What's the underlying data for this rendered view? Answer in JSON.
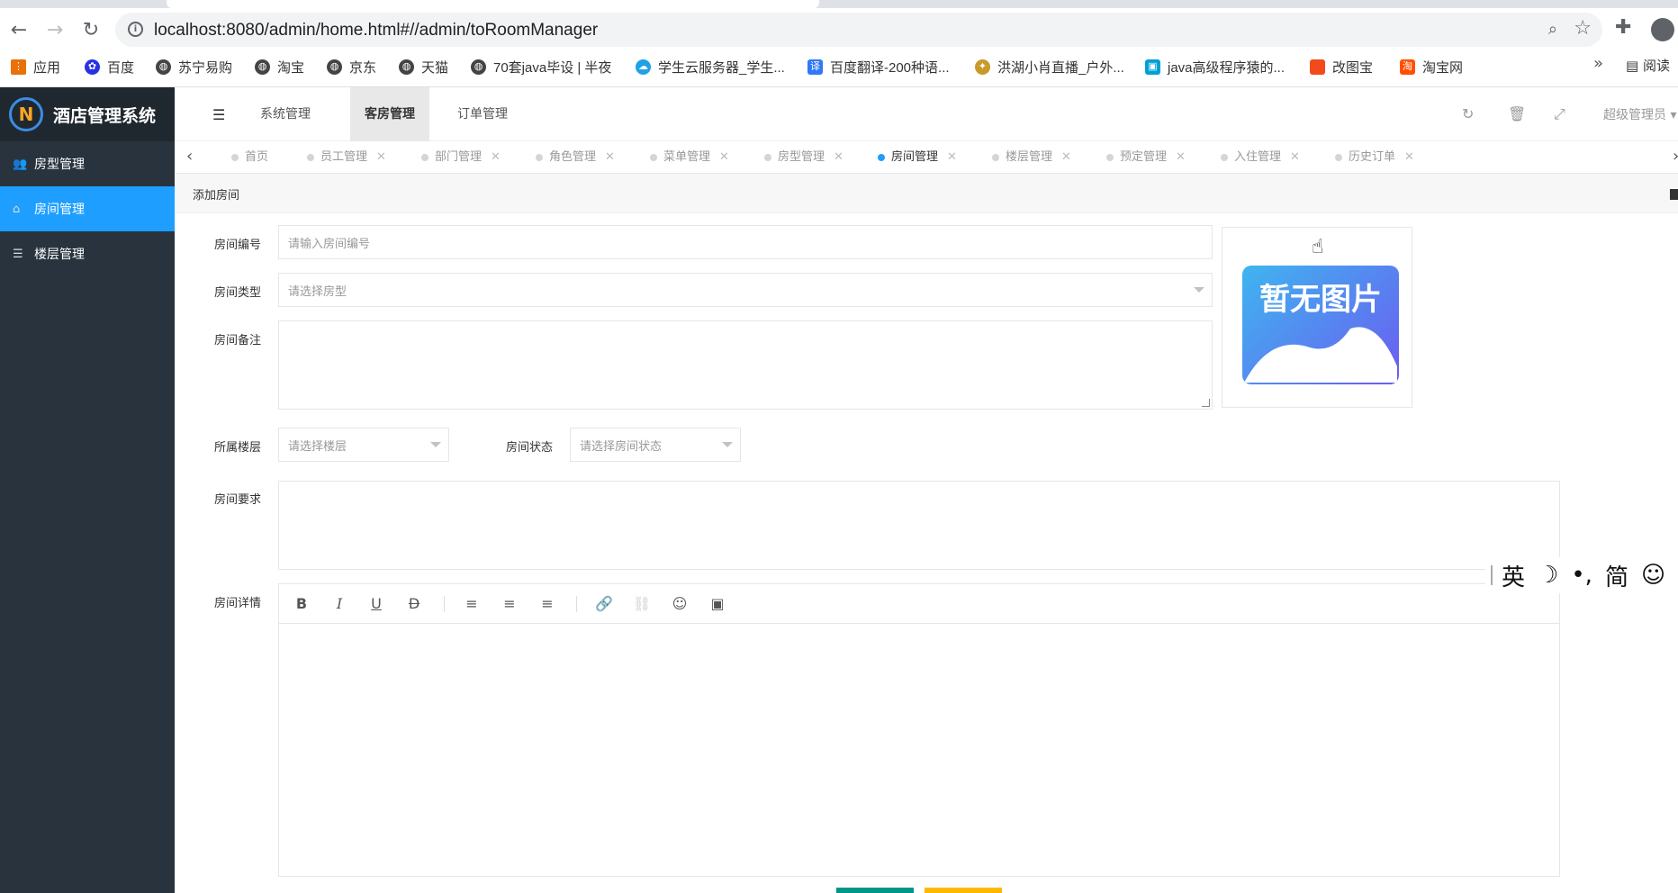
{
  "browser": {
    "url": "localhost:8080/admin/home.html#//admin/toRoomManager",
    "bookmarks": [
      {
        "label": "应用",
        "icon": "apps-grid-icon"
      },
      {
        "label": "百度",
        "icon": "baidu-paw-icon"
      },
      {
        "label": "苏宁易购",
        "icon": "globe-icon"
      },
      {
        "label": "淘宝",
        "icon": "globe-icon"
      },
      {
        "label": "京东",
        "icon": "globe-icon"
      },
      {
        "label": "天猫",
        "icon": "globe-icon"
      },
      {
        "label": "70套java毕设 | 半夜",
        "icon": "globe-icon"
      },
      {
        "label": "学生云服务器_学生...",
        "icon": "cloud-icon"
      },
      {
        "label": "百度翻译-200种语...",
        "icon": "translate-icon"
      },
      {
        "label": "洪湖小肖直播_户外...",
        "icon": "bird-icon"
      },
      {
        "label": "java高级程序猿的...",
        "icon": "bilibili-icon"
      },
      {
        "label": "改图宝",
        "icon": "square-icon"
      },
      {
        "label": "淘宝网",
        "icon": "taobao-icon"
      }
    ],
    "more": "»",
    "reading_list": "阅读"
  },
  "sidebar": {
    "app_title": "酒店管理系统",
    "items": [
      {
        "label": "房型管理",
        "icon": "users-icon",
        "active": false
      },
      {
        "label": "房间管理",
        "icon": "home-icon",
        "active": true
      },
      {
        "label": "楼层管理",
        "icon": "list-icon",
        "active": false
      }
    ]
  },
  "header": {
    "nav": [
      "系统管理",
      "客房管理",
      "订单管理"
    ],
    "active_nav": "客房管理",
    "user": "超级管理员"
  },
  "tabs": [
    {
      "label": "首页",
      "closable": false,
      "active": false
    },
    {
      "label": "员工管理",
      "closable": true,
      "active": false
    },
    {
      "label": "部门管理",
      "closable": true,
      "active": false
    },
    {
      "label": "角色管理",
      "closable": true,
      "active": false
    },
    {
      "label": "菜单管理",
      "closable": true,
      "active": false
    },
    {
      "label": "房型管理",
      "closable": true,
      "active": false
    },
    {
      "label": "房间管理",
      "closable": true,
      "active": true
    },
    {
      "label": "楼层管理",
      "closable": true,
      "active": false
    },
    {
      "label": "预定管理",
      "closable": true,
      "active": false
    },
    {
      "label": "入住管理",
      "closable": true,
      "active": false
    },
    {
      "label": "历史订单",
      "closable": true,
      "active": false
    }
  ],
  "breadcrumb": "添加房间",
  "form": {
    "room_no_label": "房间编号",
    "room_no_placeholder": "请输入房间编号",
    "room_type_label": "房间类型",
    "room_type_placeholder": "请选择房型",
    "room_note_label": "房间备注",
    "floor_label": "所属楼层",
    "floor_placeholder": "请选择楼层",
    "status_label": "房间状态",
    "status_placeholder": "请选择房间状态",
    "requirement_label": "房间要求",
    "detail_label": "房间详情",
    "image_placeholder": "暂无图片"
  },
  "editor_tools": [
    "bold-icon",
    "italic-icon",
    "underline-icon",
    "strikethrough-icon",
    "align-left-icon",
    "align-center-icon",
    "align-right-icon",
    "link-icon",
    "unlink-icon",
    "emoji-icon",
    "image-icon"
  ],
  "ime": {
    "items": [
      "英",
      "☽",
      "•,",
      "简",
      "☺"
    ]
  }
}
